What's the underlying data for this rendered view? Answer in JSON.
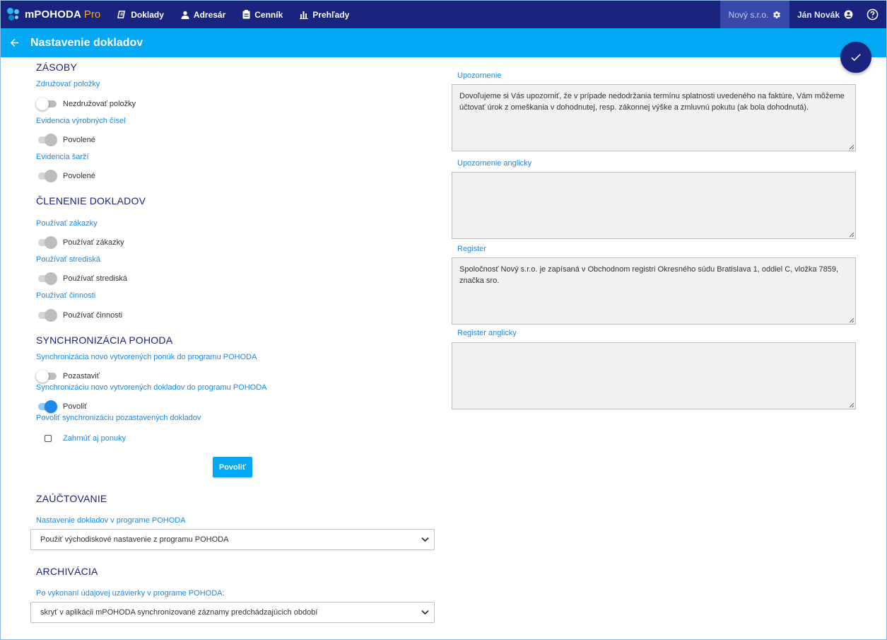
{
  "brand": {
    "name": "mPOHODA",
    "suffix": "Pro"
  },
  "nav": [
    {
      "label": "Doklady",
      "icon": "documents-icon"
    },
    {
      "label": "Adresár",
      "icon": "person-icon"
    },
    {
      "label": "Cenník",
      "icon": "price-list-icon"
    },
    {
      "label": "Prehľady",
      "icon": "bar-chart-icon"
    }
  ],
  "company": "Nový s.r.o.",
  "user": "Ján Novák",
  "page_title": "Nastavenie dokladov",
  "zasoby": {
    "title": "ZÁSOBY",
    "group_items_label": "Združovať položky",
    "group_items_toggle": "Nezdružovať položky",
    "serial_label": "Evidencia výrobných čísel",
    "serial_toggle": "Povolené",
    "batch_label": "Evidencia šarží",
    "batch_toggle": "Povolené"
  },
  "clenenie": {
    "title": "ČLENENIE DOKLADOV",
    "orders_label": "Používať zákazky",
    "orders_toggle": "Používať zákazky",
    "centers_label": "Používať strediská",
    "centers_toggle": "Používať strediská",
    "activities_label": "Používať činnosti",
    "activities_toggle": "Používať činnosti"
  },
  "sync": {
    "title": "SYNCHRONIZÁCIA POHODA",
    "offers_label": "Synchronizácia novo vytvorených ponúk do programu POHODA",
    "offers_toggle": "Pozastaviť",
    "docs_label": "Synchronizáciu novo vytvorených dokladov do programu POHODA",
    "docs_toggle": "Povoliť",
    "paused_label": "Povoliť synchronizáciu pozastavených dokladov",
    "include_offers": "Zahrnúť aj ponuky",
    "enable_button": "Povoliť"
  },
  "zauctovanie": {
    "title": "ZAÚČTOVANIE",
    "label": "Nastavenie dokladov v programe POHODA",
    "selected": "Použiť východiskové nastavenie z programu POHODA"
  },
  "archivacia": {
    "title": "ARCHIVÁCIA",
    "label": "Po vykonaní údajovej uzávierky v programe POHODA:",
    "selected": "skryť v aplikácii mPOHODA synchronizované záznamy predchádzajúcich období"
  },
  "fields": {
    "warning_label": "Upozornenie",
    "warning_value": "Dovoľujeme si Vás upozorniť, že v prípade nedodržania termínu splatnosti uvedeného na faktúre, Vám môžeme účtovať úrok z omeškania v dohodnutej, resp. zákonnej výške a zmluvnú pokutu (ak bola dohodnutá).",
    "warning_en_label": "Upozornenie anglicky",
    "warning_en_value": "",
    "register_label": "Register",
    "register_value": "Spoločnosť Nový s.r.o. je zapísaná v Obchodnom registri Okresného súdu Bratislava 1, oddiel C, vložka 7859, značka sro.",
    "register_en_label": "Register anglicky",
    "register_en_value": ""
  },
  "colors": {
    "navbar": "#1a237e",
    "titlebar": "#03a9f4",
    "accent": "#1e88e5",
    "brand_pro": "#f9a825"
  }
}
